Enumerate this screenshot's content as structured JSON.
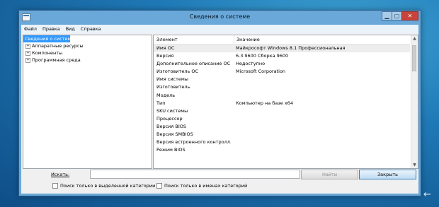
{
  "window": {
    "title": "Сведения о системе",
    "controls": {
      "minimize": "▁",
      "maximize": "▢",
      "close": "✕"
    }
  },
  "menu": [
    "Файл",
    "Правка",
    "Вид",
    "Справка"
  ],
  "tree": {
    "root": "Сведения о системе",
    "children": [
      "Аппаратные ресурсы",
      "Компоненты",
      "Программная среда"
    ],
    "expand_glyph": "+"
  },
  "details": {
    "columns": {
      "element": "Элемент",
      "value": "Значение"
    },
    "rows": [
      {
        "k": "Имя ОС",
        "v": "Майкрософт Windows 8.1 Профессиональная"
      },
      {
        "k": "Версия",
        "v": "6.3.9600 Сборка 9600"
      },
      {
        "k": "Дополнительное описание ОС",
        "v": "Недоступно"
      },
      {
        "k": "Изготовитель ОС",
        "v": "Microsoft Corporation"
      },
      {
        "k": "Имя системы",
        "v": ""
      },
      {
        "k": "Изготовитель",
        "v": ""
      },
      {
        "k": "Модель",
        "v": ""
      },
      {
        "k": "Тип",
        "v": "Компьютер на базе x64"
      },
      {
        "k": "SKU системы",
        "v": ""
      },
      {
        "k": "Процессор",
        "v": ""
      },
      {
        "k": "Версия BIOS",
        "v": ""
      },
      {
        "k": "Версия SMBIOS",
        "v": ""
      },
      {
        "k": "Версия встроенного контролл...",
        "v": ""
      },
      {
        "k": "Режим BIOS",
        "v": ""
      }
    ]
  },
  "search": {
    "label": "Искать:",
    "value": "",
    "find_button": "Найти",
    "close_button": "Закрыть",
    "option_selected_category": "Поиск только в выделенной категории",
    "option_category_names": "Поиск только в именах категорий"
  },
  "colors": {
    "selection": "#3399ff",
    "close_button": "#c9433a",
    "titlebar": "#69a8d8"
  },
  "scroll": {
    "up": "▲",
    "down": "▼"
  },
  "desktop_icon": "←"
}
